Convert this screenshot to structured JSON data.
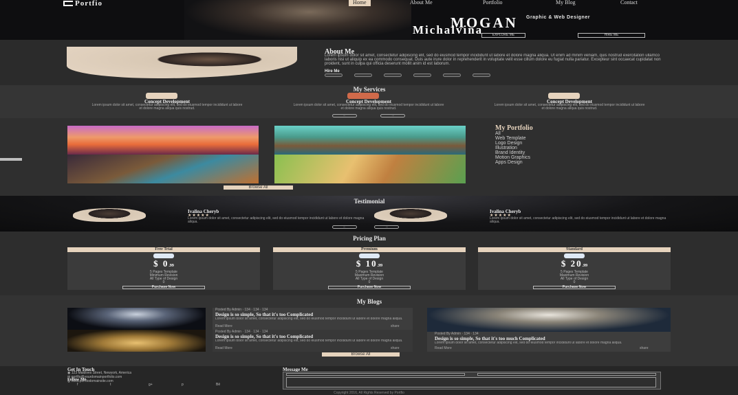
{
  "header": {
    "logo_text": "Portfio",
    "nav": [
      "Home",
      "About Me",
      "Portfolio",
      "My Blog",
      "Contact"
    ],
    "role": "Graphic & Web Designer",
    "name_first": "MOGAN",
    "name_last": "Michalvina",
    "btn_explore": "EXPLORE ME",
    "btn_hire": "HIRE ME"
  },
  "about": {
    "title": "About Me",
    "text": "Lorem ipsum dolor sit amet, consectetur adipiscing elit, sed do eiusmod tempor incididunt ut labore et dolore magna aliqua. Ut enim ad minim veniam, quis nostrud exercitation ullamco laboris nisi ut aliquip ex ea commodo consequat. Duis aute irure dolor in reprehenderit in voluptate velit esse cillum dolore eu fugiat nulla pariatur. Excepteur sint occaecat cupidatat non proident, sunt in culpa qui officia deserunt mollit anim id est laborum.",
    "hire_label": "Hire Me"
  },
  "services": {
    "title": "My Services",
    "items": [
      {
        "title": "Concept Development",
        "text": "Lorem ipsum dolor sit amet, consectetur adipiscing elit, sed do eiusmod tempor incididunt ut labore et dolore magna aliqua quis nostrud."
      },
      {
        "title": "Concept Development",
        "text": "Lorem ipsum dolor sit amet, consectetur adipiscing elit, sed do eiusmod tempor incididunt ut labore et dolore magna aliqua quis nostrud."
      },
      {
        "title": "Concept Development",
        "text": "Lorem ipsum dolor sit amet, consectetur adipiscing elit, sed do eiusmod tempor incididunt ut labore et dolore magna aliqua quis nostrud."
      }
    ]
  },
  "portfolio": {
    "title": "My Portfolio",
    "categories": [
      "All",
      "Web Template",
      "Logo Design",
      "Illustration",
      "Brand Identity",
      "Motion Graphics",
      "Apps Design"
    ],
    "browse_label": "Browse All"
  },
  "testimonial": {
    "title": "Testimonial",
    "items": [
      {
        "name": "Ivalina Cheryb",
        "stars": "★★★★★",
        "text": "Lorem ipsum dolor sit amet, consectetur adipiscing elit, sed do eiusmod tempor incididunt ut labore et dolore magna aliqua."
      },
      {
        "name": "Ivalina Cheryb",
        "stars": "★★★★★",
        "text": "Lorem ipsum dolor sit amet, consectetur adipiscing elit, sed do eiusmod tempor incididunt ut labore et dolore magna aliqua."
      }
    ]
  },
  "pricing": {
    "title": "Pricing Plan",
    "plans": [
      {
        "name": "Free Trial",
        "currency": "$",
        "amount": "0",
        "cents": ".99",
        "features": [
          "5 Pages Template",
          "Minimum Revision",
          "All Type of Design",
          "0"
        ],
        "button": "Purchase Now"
      },
      {
        "name": "Premium",
        "currency": "$",
        "amount": "10",
        "cents": ".99",
        "features": [
          "5 Pages Template",
          "Maximum Revision",
          "All Type of Design",
          "0"
        ],
        "button": "Purchase Now"
      },
      {
        "name": "Standard",
        "currency": "$",
        "amount": "20",
        "cents": ".99",
        "features": [
          "5 Pages Template",
          "Maximum Revision",
          "All Type of Design",
          "0"
        ],
        "button": "Purchase Now"
      }
    ]
  },
  "blogs": {
    "title": "My Blogs",
    "posts": [
      {
        "meta": "Posted By Admin  ·  134  ·  134  ·  134",
        "title": "Design is so simple, So that it's too Complicated",
        "text": "Lorem ipsum dolor sit amet, consectetur adipiscing elit, sed do eiusmod tempor incididunt ut labore et dolore magna aliqua.",
        "read": "Read More",
        "share": "share"
      },
      {
        "meta": "Posted By Admin  ·  134  ·  134  ·  134",
        "title": "Design is so simple, So that it's too Complicated",
        "text": "Lorem ipsum dolor sit amet, consectetur adipiscing elit, sed do eiusmod tempor incididunt ut labore et dolore magna aliqua.",
        "read": "Read More",
        "share": "share"
      },
      {
        "meta": "Posted By Admin  ·  134  ·  134",
        "title": "Design is so simple, So that it's too much Complicated",
        "text": "Lorem ipsum dolor sit amet, consectetur adipiscing elit, sed do eiusmod tempor incididunt ut labore et dolore magna aliqua.",
        "read": "Read More",
        "share": "share"
      }
    ],
    "browse_label": "Browse All"
  },
  "footer": {
    "contact_title": "Get In Touch",
    "address": "123 Maldives Street, Newyork, America",
    "email": "portfio@yourdomainportfolio.com",
    "web": "www.portfiodomainsite.com",
    "follow_title": "Follow Me",
    "message_title": "Message Me",
    "copyright": "Copyright 2016, All Rights Reserved by Portfio"
  },
  "colors": {
    "accent": "#e6d3bd",
    "bg": "#2e2e2e",
    "header": "#0e0e10"
  }
}
